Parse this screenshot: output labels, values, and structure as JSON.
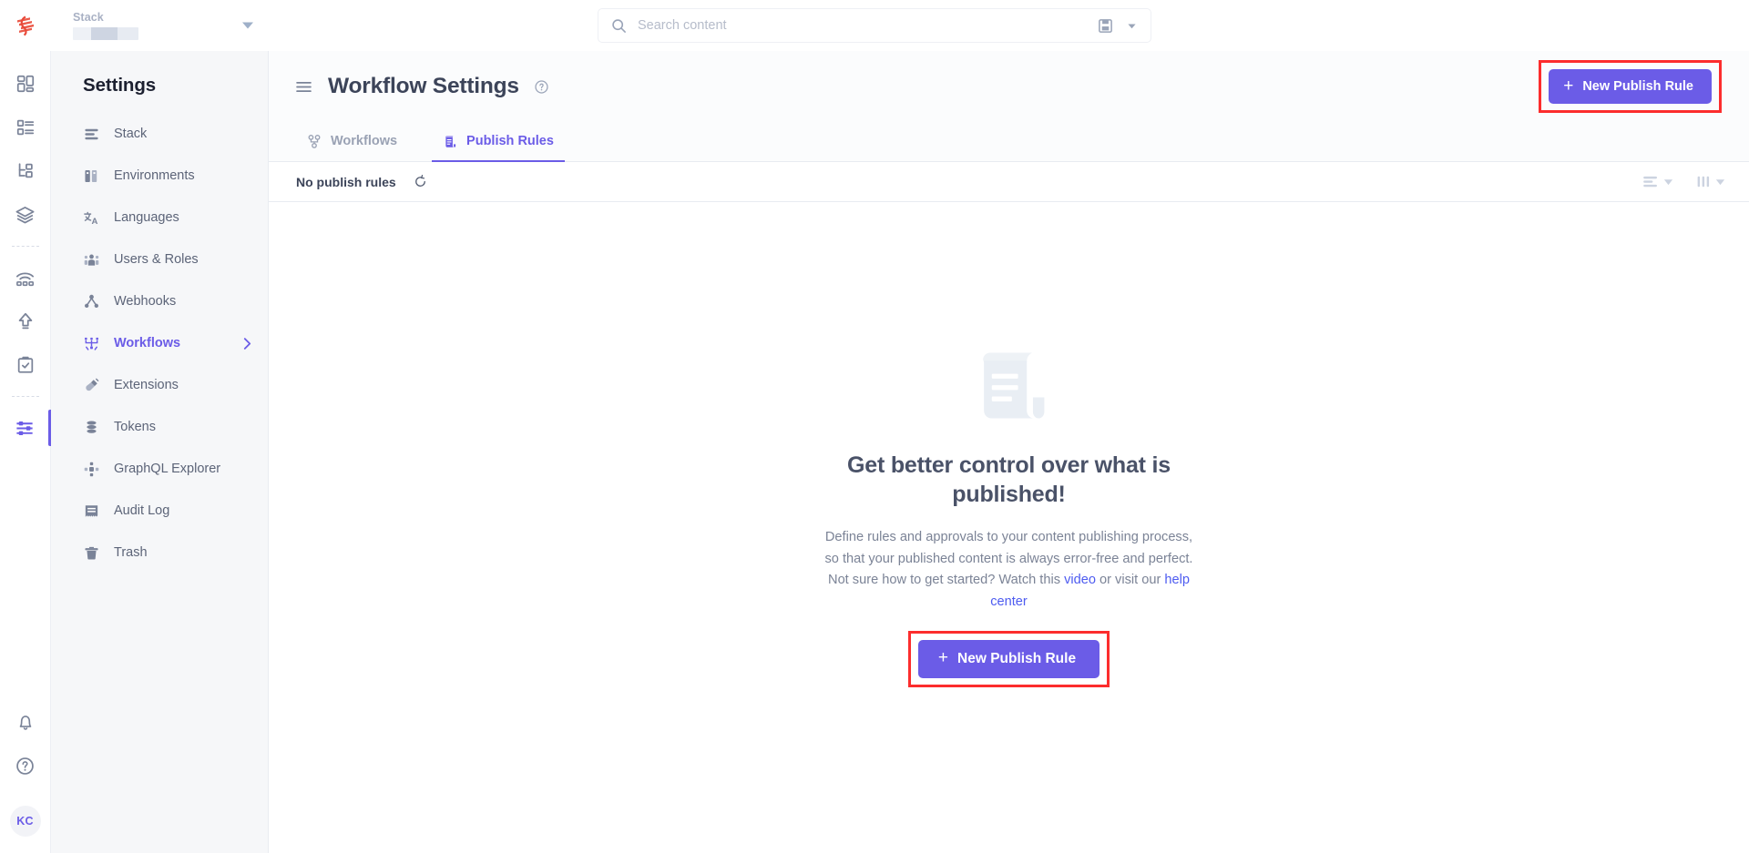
{
  "topbar": {
    "logo_icon": "contentstack-logo-icon",
    "stack_label": "Stack",
    "stack_value": "",
    "stack_caret_icon": "chevron-down-icon",
    "search": {
      "icon": "search-icon",
      "placeholder": "Search content",
      "value": "",
      "save_icon": "save-disk-icon",
      "caret_icon": "chevron-down-icon"
    }
  },
  "rail": {
    "items": [
      {
        "name": "dashboard-icon",
        "label": "Dashboard",
        "active": false
      },
      {
        "name": "entries-icon",
        "label": "Entries",
        "active": false
      },
      {
        "name": "content-models-icon",
        "label": "Content Models",
        "active": false
      },
      {
        "name": "assets-icon",
        "label": "Assets",
        "active": false
      },
      {
        "name": "live-preview-icon",
        "label": "Live Preview",
        "active": false
      },
      {
        "name": "releases-icon",
        "label": "Releases",
        "active": false
      },
      {
        "name": "tasks-icon",
        "label": "Tasks",
        "active": false
      },
      {
        "name": "settings-sliders-icon",
        "label": "Settings",
        "active": true
      }
    ],
    "bottom": {
      "bell_icon": "bell-icon",
      "help_icon": "help-circle-icon",
      "avatar_initials": "KC"
    }
  },
  "sidebar": {
    "title": "Settings",
    "items": [
      {
        "label": "Stack",
        "icon": "stack-icon",
        "active": false,
        "chevron": false
      },
      {
        "label": "Environments",
        "icon": "environments-icon",
        "active": false,
        "chevron": false
      },
      {
        "label": "Languages",
        "icon": "languages-icon",
        "active": false,
        "chevron": false
      },
      {
        "label": "Users & Roles",
        "icon": "users-roles-icon",
        "active": false,
        "chevron": false
      },
      {
        "label": "Webhooks",
        "icon": "webhooks-icon",
        "active": false,
        "chevron": false
      },
      {
        "label": "Workflows",
        "icon": "workflows-icon",
        "active": true,
        "chevron": true
      },
      {
        "label": "Extensions",
        "icon": "extensions-icon",
        "active": false,
        "chevron": false
      },
      {
        "label": "Tokens",
        "icon": "tokens-icon",
        "active": false,
        "chevron": false
      },
      {
        "label": "GraphQL Explorer",
        "icon": "graphql-icon",
        "active": false,
        "chevron": false
      },
      {
        "label": "Audit Log",
        "icon": "audit-log-icon",
        "active": false,
        "chevron": false
      },
      {
        "label": "Trash",
        "icon": "trash-icon",
        "active": false,
        "chevron": false
      }
    ]
  },
  "header": {
    "menu_icon": "hamburger-menu-icon",
    "title": "Workflow Settings",
    "help_icon": "help-circle-icon",
    "new_rule_label": "New Publish Rule",
    "new_rule_plus": "+"
  },
  "tabs": [
    {
      "label": "Workflows",
      "icon": "workflows-tab-icon",
      "active": false
    },
    {
      "label": "Publish Rules",
      "icon": "publish-rules-tab-icon",
      "active": true
    }
  ],
  "list_toolbar": {
    "count_text": "No publish rules",
    "refresh_icon": "refresh-icon",
    "sort_icon": "sort-lines-icon",
    "sort_caret_icon": "chevron-down-icon",
    "columns_icon": "columns-icon",
    "columns_caret_icon": "chevron-down-icon"
  },
  "empty_state": {
    "illustration_icon": "scroll-document-icon",
    "heading": "Get better control over what is published!",
    "description_part1": "Define rules and approvals to your content publishing process, so that your published content is always error-free and perfect. Not sure how to get started? Watch this ",
    "link_video": "video",
    "description_part2": " or visit our ",
    "link_help_center": "help center",
    "cta_label": "New Publish Rule",
    "cta_plus": "+"
  },
  "colors": {
    "accent_purple": "#6b5ce7",
    "highlight_red": "#fc2d2d",
    "link_blue": "#4d5bf0",
    "sidebar_bg": "#f6f7f9",
    "text_dark": "#3c4459",
    "text_muted": "#7b8396"
  }
}
